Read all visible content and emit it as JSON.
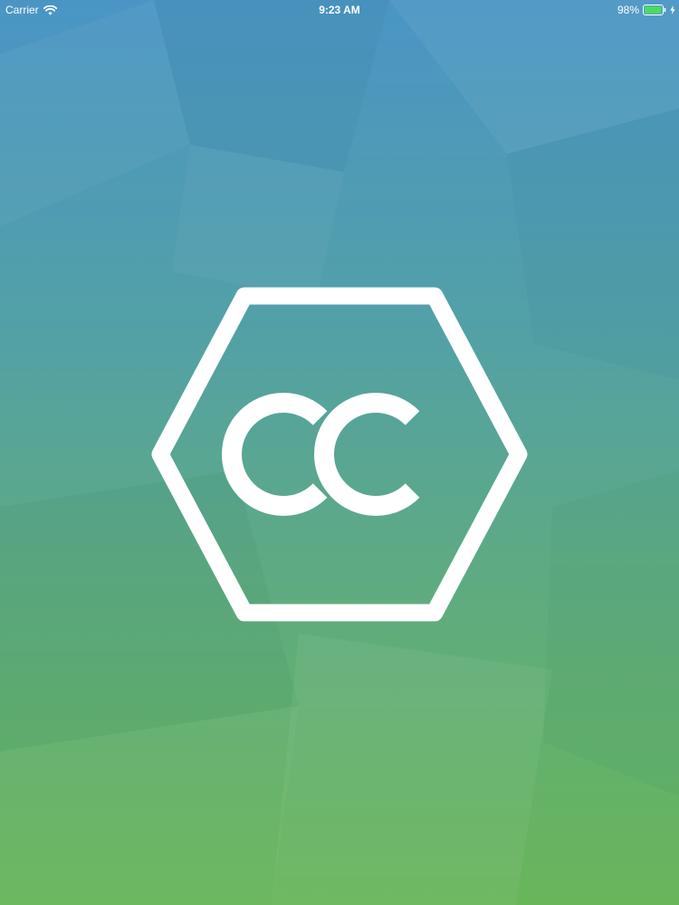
{
  "status_bar": {
    "carrier": "Carrier",
    "time": "9:23 AM",
    "battery_percent": "98%",
    "battery_level": 0.98,
    "wifi_icon": "wifi-icon",
    "battery_icon": "battery-icon",
    "charging_icon": "bolt-icon"
  },
  "splash": {
    "logo_text": "CC",
    "logo_shape": "hexagon",
    "logo_color": "#ffffff",
    "background_top_color": "#4a95c5",
    "background_bottom_color": "#68b65a"
  }
}
